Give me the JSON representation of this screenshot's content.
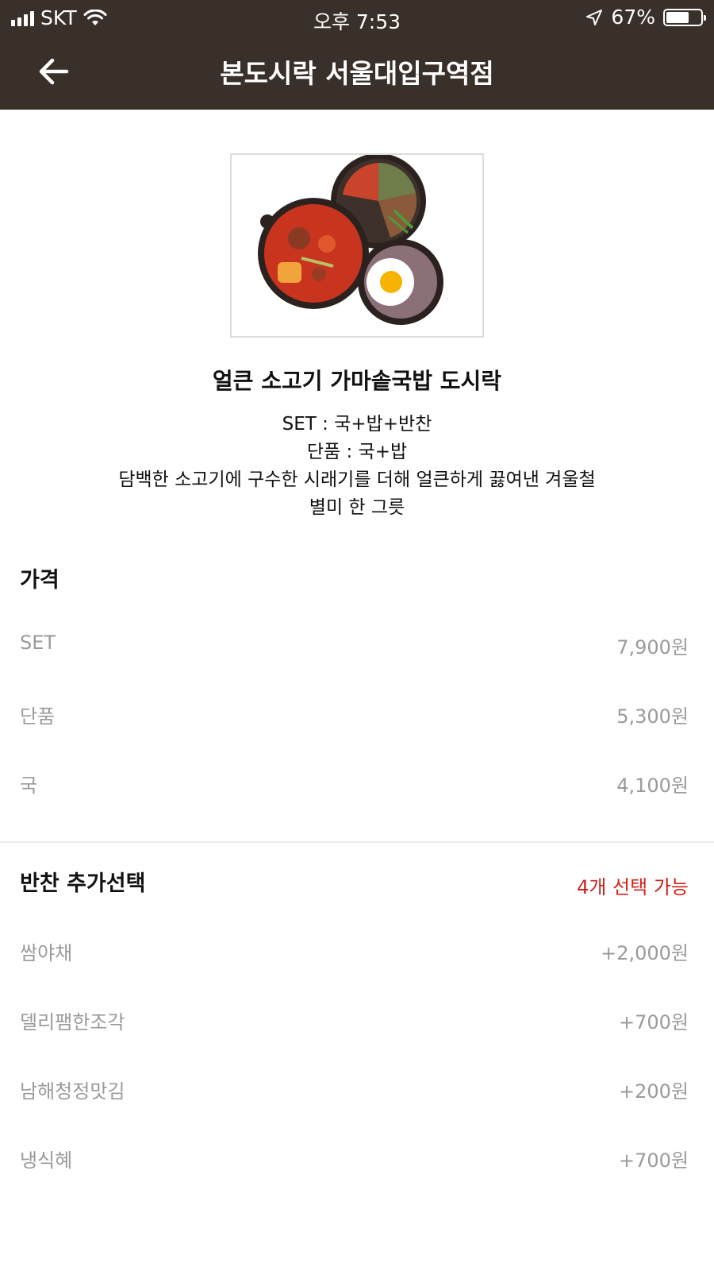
{
  "status": {
    "carrier": "SKT",
    "time": "오후 7:53",
    "battery_text": "67%",
    "battery_level": 0.67
  },
  "nav": {
    "title": "본도시락 서울대입구역점",
    "back_icon": "arrow-left-icon"
  },
  "product": {
    "name": "얼큰 소고기 가마솥국밥 도시락",
    "description_lines": [
      "SET : 국+밥+반찬",
      "단품 : 국+밥",
      "담백한 소고기에 구수한 시래기를 더해 얼큰하게 끓여낸 겨울철",
      "별미 한 그릇"
    ]
  },
  "price_section": {
    "title": "가격",
    "rows": [
      {
        "label": "SET",
        "price": "7,900원"
      },
      {
        "label": "단품",
        "price": "5,300원"
      },
      {
        "label": "국",
        "price": "4,100원"
      }
    ]
  },
  "side_section": {
    "title": "반찬 추가선택",
    "available_text": "4개 선택 가능",
    "rows": [
      {
        "label": "쌈야채",
        "price": "+2,000원"
      },
      {
        "label": "델리팸한조각",
        "price": "+700원"
      },
      {
        "label": "남해청정맛김",
        "price": "+200원"
      },
      {
        "label": "냉식혜",
        "price": "+700원"
      }
    ]
  },
  "colors": {
    "header_bg": "#3a302a",
    "accent_red": "#d0211c",
    "muted_text": "#9a9a9a"
  }
}
